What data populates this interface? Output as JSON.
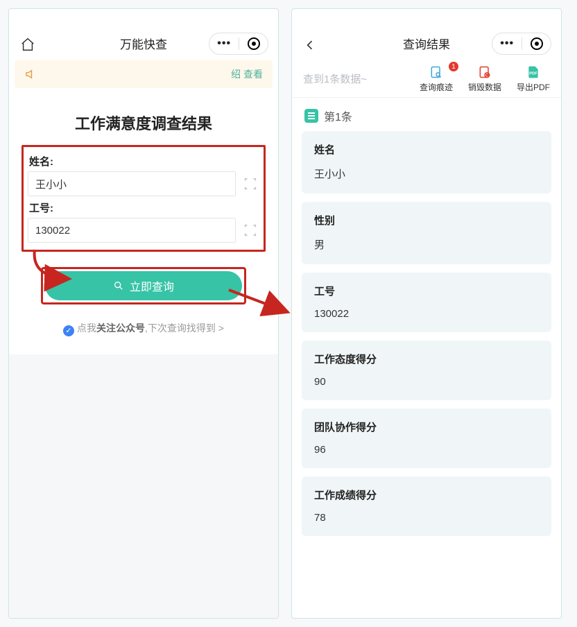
{
  "phone1": {
    "title": "万能快查",
    "notice_view": "绍 查看",
    "form_title": "工作满意度调查结果",
    "name_label": "姓名:",
    "name_value": "王小小",
    "id_label": "工号:",
    "id_value": "130022",
    "submit_label": "立即查询",
    "follow_prefix": "点我",
    "follow_bold": "关注公众号",
    "follow_suffix": ",下次查询找得到 >"
  },
  "phone2": {
    "title": "查询结果",
    "hint": "查到1条数据~",
    "tools": {
      "trace": "查询痕迹",
      "trace_badge": "1",
      "destroy": "销毁数据",
      "export": "导出PDF"
    },
    "section": "第1条",
    "rows": [
      {
        "k": "姓名",
        "v": "王小小"
      },
      {
        "k": "性别",
        "v": "男"
      },
      {
        "k": "工号",
        "v": "130022"
      },
      {
        "k": "工作态度得分",
        "v": "90"
      },
      {
        "k": "团队协作得分",
        "v": "96"
      },
      {
        "k": "工作成绩得分",
        "v": "78"
      }
    ]
  }
}
